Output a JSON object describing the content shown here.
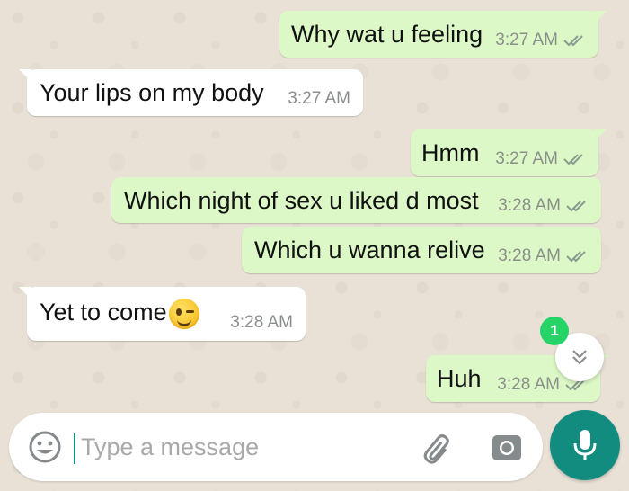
{
  "messages": [
    {
      "direction": "out",
      "text": "Why wat u feeling",
      "time": "3:27 AM",
      "ticks": true
    },
    {
      "direction": "in",
      "text": "Your lips on my body",
      "time": "3:27 AM",
      "ticks": false
    },
    {
      "direction": "out",
      "text": "Hmm",
      "time": "3:27 AM",
      "ticks": true
    },
    {
      "direction": "out",
      "text": "Which night of sex u liked d most",
      "time": "3:28 AM",
      "ticks": true
    },
    {
      "direction": "out",
      "text": "Which u wanna relive",
      "time": "3:28 AM",
      "ticks": true
    },
    {
      "direction": "in",
      "text": "Yet to come",
      "emoji": "winking-face",
      "time": "3:28 AM",
      "ticks": false
    },
    {
      "direction": "out",
      "text": "Huh",
      "time": "3:28 AM",
      "ticks": true
    }
  ],
  "scroll_down": {
    "unread_count": "1",
    "icon": "double-chevron-down-icon"
  },
  "composer": {
    "placeholder": "Type a message",
    "emoji_icon": "emoji-icon",
    "attach_icon": "paperclip-icon",
    "camera_icon": "camera-icon",
    "mic_icon": "microphone-icon"
  },
  "colors": {
    "outgoing_bubble": "#dcf8c6",
    "incoming_bubble": "#ffffff",
    "accent": "#128c7e",
    "badge": "#25d366",
    "tick": "#8a9a8f"
  }
}
